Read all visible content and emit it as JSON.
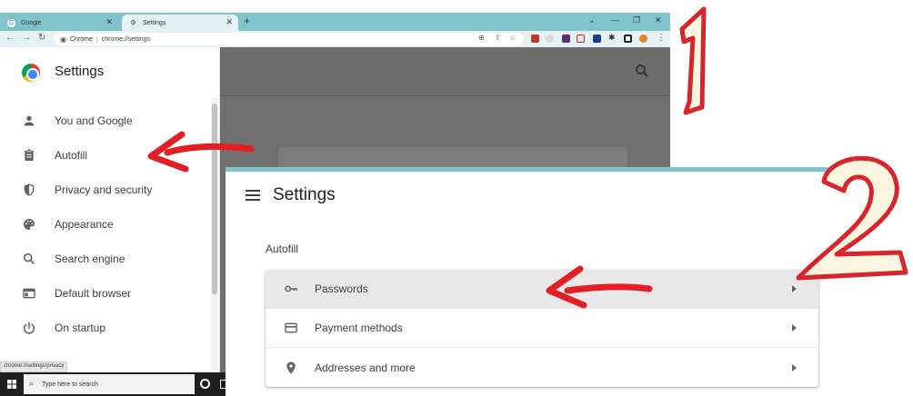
{
  "browser": {
    "tabs": [
      {
        "label": "Google",
        "active": false
      },
      {
        "label": "Settings",
        "active": true
      }
    ],
    "new_tab": "+",
    "address": {
      "site_label": "Chrome",
      "url": "chrome://settings"
    },
    "status_url": "chrome://settings/privacy"
  },
  "sidebar": {
    "title": "Settings",
    "items": [
      {
        "label": "You and Google",
        "icon": "person-icon"
      },
      {
        "label": "Autofill",
        "icon": "clipboard-icon"
      },
      {
        "label": "Privacy and security",
        "icon": "shield-icon"
      },
      {
        "label": "Appearance",
        "icon": "palette-icon"
      },
      {
        "label": "Search engine",
        "icon": "search-icon"
      },
      {
        "label": "Default browser",
        "icon": "browser-window-icon"
      },
      {
        "label": "On startup",
        "icon": "power-icon"
      }
    ]
  },
  "taskbar": {
    "search_placeholder": "Type here to search"
  },
  "panel": {
    "title": "Settings",
    "section": "Autofill",
    "rows": [
      {
        "label": "Passwords",
        "icon": "key-icon"
      },
      {
        "label": "Payment methods",
        "icon": "credit-card-icon"
      },
      {
        "label": "Addresses and more",
        "icon": "location-pin-icon"
      }
    ]
  },
  "annotations": {
    "step_one": "1",
    "step_two": "2"
  },
  "colors": {
    "tabstrip": "#7fc3cc",
    "toolbar": "#e6f3f4",
    "arrow": "#e31e24",
    "overlay": "#707070"
  }
}
